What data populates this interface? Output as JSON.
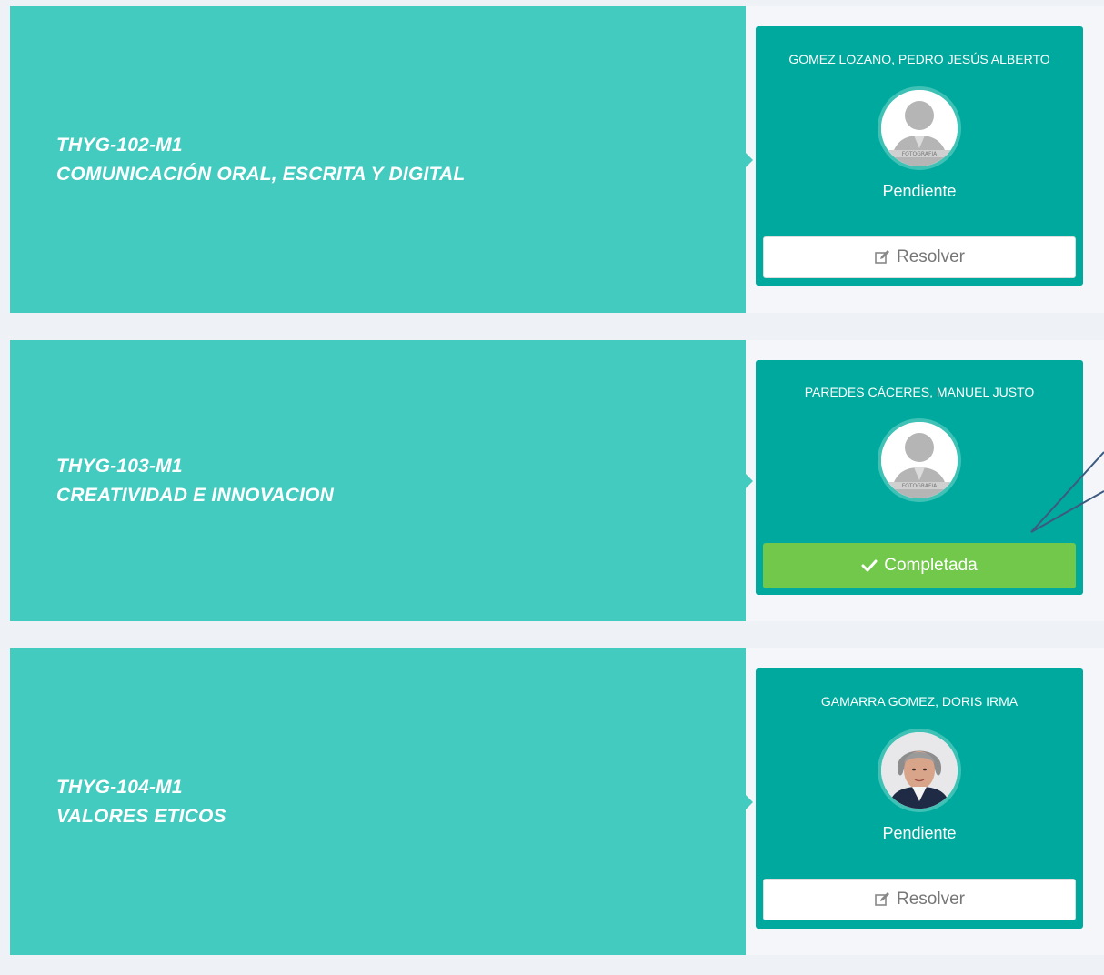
{
  "courses": [
    {
      "code": "THYG-102-M1",
      "name": "COMUNICACIÓN ORAL, ESCRITA Y DIGITAL",
      "teacher": "GOMEZ LOZANO, PEDRO JESÚS ALBERTO",
      "status": "Pendiente",
      "action_label": "Resolver",
      "avatar": "placeholder-photo",
      "action_icon": "edit-icon"
    },
    {
      "code": "THYG-103-M1",
      "name": "CREATIVIDAD E INNOVACION",
      "teacher": "PAREDES CÁCERES, MANUEL JUSTO",
      "status": "",
      "action_label": "Completada",
      "avatar": "placeholder-photo",
      "action_icon": "check-icon"
    },
    {
      "code": "THYG-104-M1",
      "name": "VALORES ETICOS",
      "teacher": "GAMARRA GOMEZ, DORIS IRMA",
      "status": "Pendiente",
      "action_label": "Resolver",
      "avatar": "teacher-photo",
      "action_icon": "edit-icon"
    }
  ],
  "colors": {
    "course_panel": "#44cbbf",
    "teacher_card": "#00a99d",
    "completed_button": "#72c84a",
    "page_background": "#eef1f6"
  }
}
